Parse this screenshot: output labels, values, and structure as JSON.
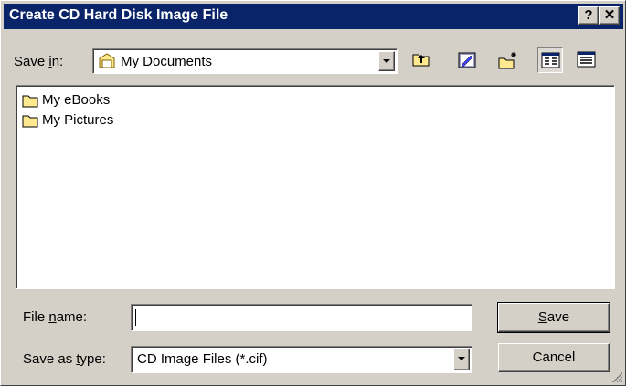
{
  "window": {
    "title": "Create CD Hard Disk Image File",
    "help_label": "?",
    "close_label": "✕"
  },
  "save_in": {
    "label_pre": "Save ",
    "label_accel": "i",
    "label_post": "n:",
    "value": "My Documents",
    "icon": "my-documents-icon"
  },
  "toolbar": {
    "buttons": [
      "up-one-level-icon",
      "desktop-icon",
      "new-folder-icon",
      "list-view-icon",
      "details-view-icon"
    ],
    "pressed": "list-view-icon"
  },
  "files": [
    {
      "name": "My eBooks",
      "icon": "folder-icon"
    },
    {
      "name": "My Pictures",
      "icon": "folder-icon"
    }
  ],
  "file_name": {
    "label_pre": "File ",
    "label_accel": "n",
    "label_post": "ame:",
    "value": ""
  },
  "save_as_type": {
    "label_pre": "Save as ",
    "label_accel": "t",
    "label_post": "ype:",
    "value": "CD Image Files (*.cif)"
  },
  "buttons": {
    "save_accel": "S",
    "save_rest": "ave",
    "cancel": "Cancel"
  },
  "colors": {
    "title_bar": "#0a246a",
    "face": "#d4d0c8",
    "folder": "#ffe98f"
  }
}
